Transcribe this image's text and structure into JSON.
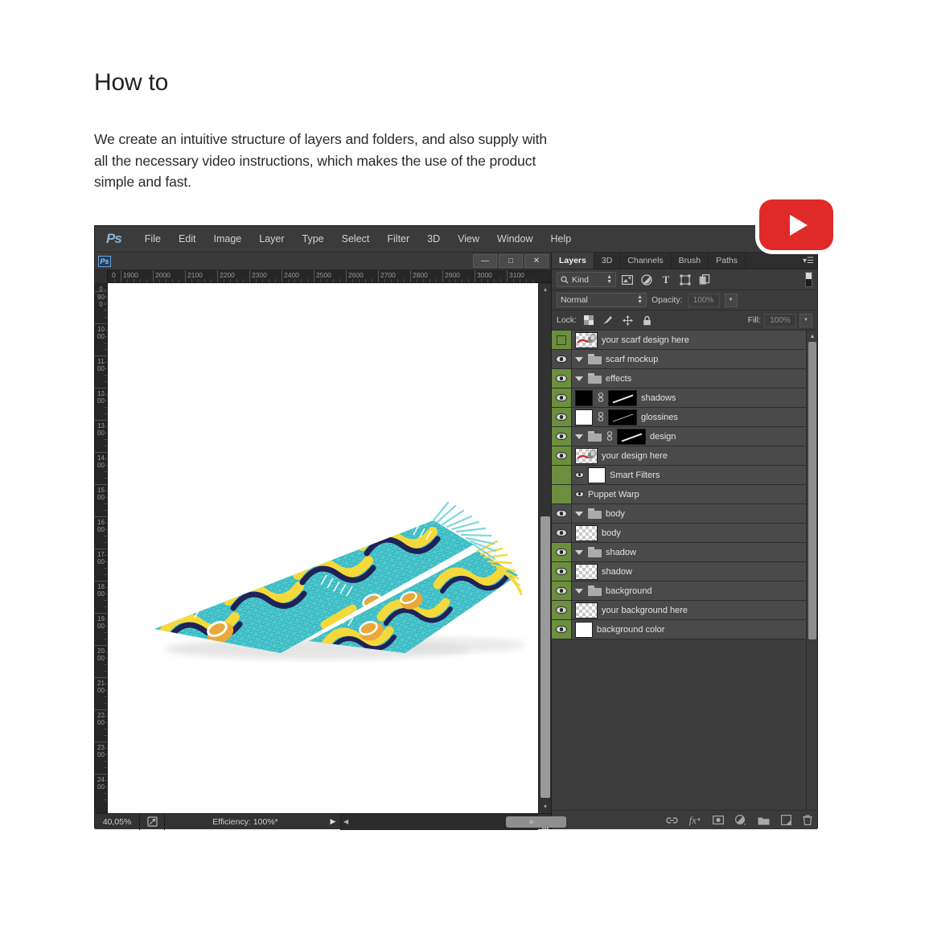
{
  "intro": {
    "title": "How to",
    "body": "We create an intuitive structure of layers and folders, and also supply with all the necessary video instructions, which makes the use of the product simple and fast."
  },
  "youtube": {
    "name": "youtube-play-badge",
    "color": "#e02a28"
  },
  "photoshop": {
    "logo": "Ps",
    "menu": [
      "File",
      "Edit",
      "Image",
      "Layer",
      "Type",
      "Select",
      "Filter",
      "3D",
      "View",
      "Window",
      "Help"
    ],
    "document_window": {
      "icon": "Ps",
      "minimize": "—",
      "maximize": "□",
      "close": "✕"
    },
    "rulers": {
      "horizontal_labels": [
        "0",
        "1900",
        "2000",
        "2100",
        "2200",
        "2300",
        "2400",
        "2500",
        "2600",
        "2700",
        "2800",
        "2900",
        "3000",
        "3100"
      ],
      "vertical_labels": [
        "0",
        "900",
        "1000",
        "1100",
        "1200",
        "1300",
        "1400",
        "1500",
        "1600",
        "1700",
        "1800",
        "1900",
        "2000",
        "2100",
        "2200",
        "2300",
        "2400"
      ]
    },
    "statusbar": {
      "zoom": "40,05%",
      "efficiency": "Efficiency: 100%*"
    },
    "panel": {
      "tabs": [
        {
          "label": "Layers",
          "active": true
        },
        {
          "label": "3D",
          "active": false
        },
        {
          "label": "Channels",
          "active": false
        },
        {
          "label": "Brush",
          "active": false
        },
        {
          "label": "Paths",
          "active": false
        }
      ],
      "filter": {
        "kind_label": "Kind",
        "icons": [
          "pixel-layer-filter-icon",
          "adjustment-layer-filter-icon",
          "type-layer-filter-icon",
          "shape-layer-filter-icon",
          "smart-object-filter-icon"
        ],
        "toggle": "filter-enable-toggle"
      },
      "blend": {
        "mode": "Normal",
        "opacity_label": "Opacity:",
        "opacity_value": "100%"
      },
      "lock": {
        "label": "Lock:",
        "icons": [
          "lock-transparency-icon",
          "lock-image-icon",
          "lock-position-icon",
          "lock-all-icon"
        ],
        "fill_label": "Fill:",
        "fill_value": "100%"
      },
      "layers": [
        {
          "name": "your scarf design here",
          "visible": true,
          "selected": true,
          "marker": "green-square",
          "indent": 0,
          "type": "smart-object",
          "thumb": "transparent"
        },
        {
          "name": "scarf mockup",
          "visible": true,
          "selected": false,
          "marker": "eye",
          "indent": 0,
          "type": "group",
          "caret": true
        },
        {
          "name": "effects",
          "visible": true,
          "selected": true,
          "marker": "eye",
          "indent": 1,
          "type": "group",
          "caret": true
        },
        {
          "name": "shadows",
          "visible": true,
          "selected": true,
          "marker": "eye",
          "indent": 2,
          "type": "layer",
          "thumb": "black",
          "link": true,
          "mask": "streak"
        },
        {
          "name": "glossines",
          "visible": true,
          "selected": true,
          "marker": "eye",
          "indent": 2,
          "type": "layer",
          "thumb": "white",
          "link": true,
          "mask": "streak-thin"
        },
        {
          "name": "design",
          "visible": true,
          "selected": true,
          "marker": "eye",
          "indent": 1,
          "type": "group",
          "caret": true,
          "link": true,
          "mask": "streak"
        },
        {
          "name": "your design here",
          "visible": true,
          "selected": true,
          "marker": "eye",
          "indent": 2,
          "type": "smart-object",
          "thumb": "transparent"
        },
        {
          "name": "Smart Filters",
          "visible": true,
          "selected": true,
          "marker": "none",
          "indent": 3,
          "type": "smart-filter",
          "thumb": "white",
          "smalleye": true
        },
        {
          "name": "Puppet Warp",
          "visible": true,
          "selected": true,
          "marker": "none",
          "indent": 3,
          "type": "smart-filter-entry",
          "smalleye": true
        },
        {
          "name": "body",
          "visible": true,
          "selected": false,
          "marker": "eye",
          "indent": 1,
          "type": "group",
          "caret": true
        },
        {
          "name": "body",
          "visible": true,
          "selected": false,
          "marker": "eye",
          "indent": 2,
          "type": "layer",
          "thumb": "transparent"
        },
        {
          "name": "shadow",
          "visible": true,
          "selected": true,
          "marker": "eye",
          "indent": 1,
          "type": "group",
          "caret": true
        },
        {
          "name": "shadow",
          "visible": true,
          "selected": true,
          "marker": "eye",
          "indent": 2,
          "type": "layer",
          "thumb": "transparent"
        },
        {
          "name": "background",
          "visible": true,
          "selected": true,
          "marker": "eye",
          "indent": 0,
          "type": "group",
          "caret": true
        },
        {
          "name": "your background here",
          "visible": true,
          "selected": true,
          "marker": "eye",
          "indent": 1,
          "type": "layer",
          "thumb": "transparent"
        },
        {
          "name": "background color",
          "visible": true,
          "selected": true,
          "marker": "eye",
          "indent": 1,
          "type": "layer",
          "thumb": "white"
        }
      ],
      "bottom_icons": [
        "link-layers-icon",
        "layer-style-fx-icon",
        "add-mask-icon",
        "adjustment-layer-icon",
        "new-group-icon",
        "new-layer-icon",
        "delete-layer-icon"
      ]
    }
  },
  "colors": {
    "selection_green": "#6b8f3e",
    "panel_bg": "#3b3b3b",
    "row_bg": "#4a4a4a",
    "scarf_teal": "#4fc9cf",
    "scarf_yellow": "#f5d93a",
    "scarf_navy": "#1f2258",
    "scarf_orange": "#e8a93a"
  }
}
